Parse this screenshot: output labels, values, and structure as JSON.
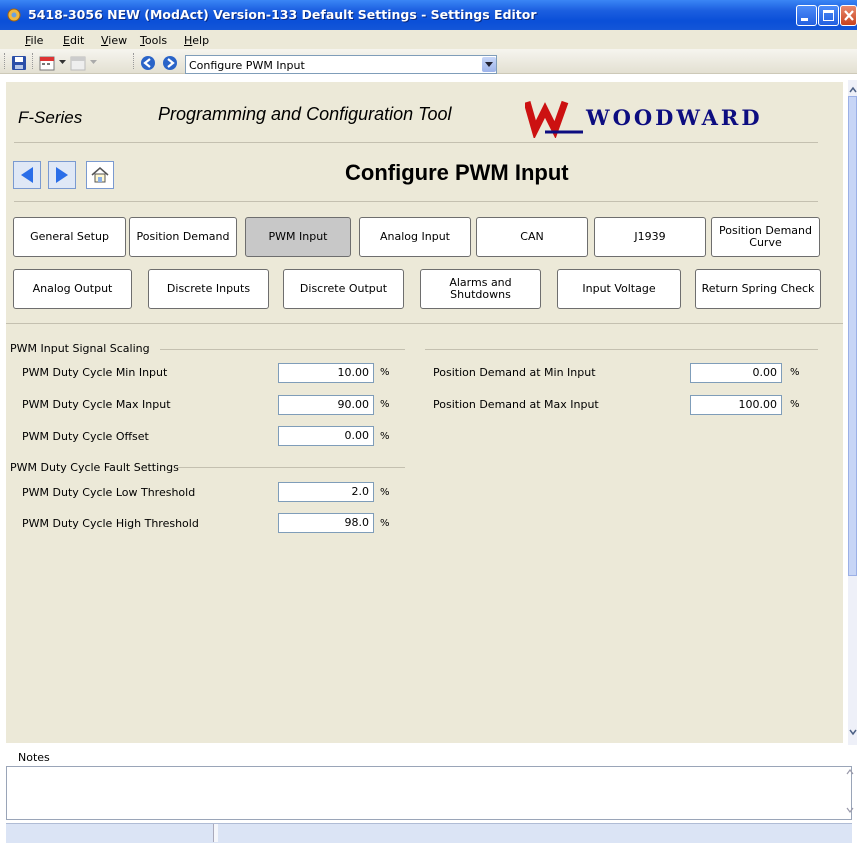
{
  "window": {
    "title": "5418-3056 NEW (ModAct) Version-133 Default Settings - Settings Editor"
  },
  "menu": [
    {
      "label": "File",
      "underline": "F",
      "rest": "ile"
    },
    {
      "label": "Edit",
      "underline": "E",
      "rest": "dit"
    },
    {
      "label": "View",
      "underline": "V",
      "rest": "iew"
    },
    {
      "label": "Tools",
      "underline": "T",
      "rest": "ools"
    },
    {
      "label": "Help",
      "underline": "H",
      "rest": "elp"
    }
  ],
  "toolbar": {
    "page_select_value": "Configure PWM Input"
  },
  "header": {
    "series": "F-Series",
    "tool_name": "Programming and Configuration Tool",
    "brand": "WOODWARD"
  },
  "page": {
    "title": "Configure  PWM Input"
  },
  "tabs_row1": [
    "General Setup",
    "Position Demand",
    "PWM Input",
    "Analog Input",
    "CAN",
    "J1939",
    "Position Demand Curve"
  ],
  "tabs_row2": [
    "Analog Output",
    "Discrete Inputs",
    "Discrete Output",
    "Alarms and Shutdowns",
    "Input Voltage",
    "Return Spring Check"
  ],
  "active_tab": "PWM Input",
  "scaling": {
    "group_label": "PWM Input Signal Scaling",
    "fields": [
      {
        "label": "PWM Duty Cycle Min Input",
        "value": "10.00",
        "unit": "%"
      },
      {
        "label": "PWM Duty Cycle Max Input",
        "value": "90.00",
        "unit": "%"
      },
      {
        "label": "PWM Duty Cycle Offset",
        "value": "0.00",
        "unit": "%"
      }
    ]
  },
  "fault": {
    "group_label": "PWM Duty Cycle Fault Settings",
    "fields": [
      {
        "label": "PWM Duty Cycle Low Threshold",
        "value": "2.0",
        "unit": "%"
      },
      {
        "label": "PWM Duty Cycle High Threshold",
        "value": "98.0",
        "unit": "%"
      }
    ]
  },
  "position": {
    "fields": [
      {
        "label": "Position Demand at Min Input",
        "value": "0.00",
        "unit": "%"
      },
      {
        "label": "Position Demand at Max Input",
        "value": "100.00",
        "unit": "%"
      }
    ]
  },
  "notes": {
    "label": "Notes",
    "value": ""
  },
  "colors": {
    "titlebar": "#0a4fd8",
    "panel": "#ece9d8",
    "brand": "#0d0d80",
    "logo_red": "#cc1111",
    "active_tab": "#c8c8c8"
  }
}
